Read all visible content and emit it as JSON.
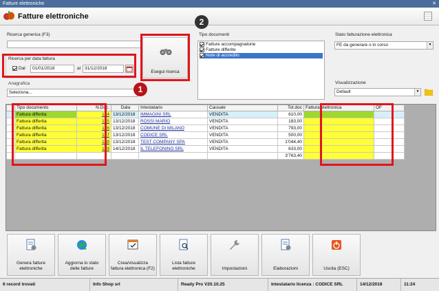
{
  "window": {
    "title": "Fatture elettroniche",
    "close": "✕"
  },
  "header": {
    "title": "Fatture elettroniche"
  },
  "search": {
    "generic_label": "Ricerca generica (F3)",
    "generic_value": "",
    "date_label": "Ricerca per data fattura",
    "from_label": "Dal",
    "from_value": "01/01/2018",
    "to_label": "al",
    "to_value": "31/12/2018",
    "anagrafica_label": "Anagrafica",
    "anagrafica_value": "Seleziona..."
  },
  "search_button": {
    "label": "Esegui ricerca"
  },
  "doc_types": {
    "label": "Tipo documenti",
    "items": [
      {
        "label": "Fatture accompagnatorie",
        "selected": false
      },
      {
        "label": "Fatture differite",
        "selected": false
      },
      {
        "label": "Note di accredito",
        "selected": true
      }
    ]
  },
  "stato": {
    "label": "Stato fatturazione elettronica",
    "value": "FE da generare o in corso"
  },
  "visualizzazione": {
    "label": "Visualizzazione",
    "value": "Default"
  },
  "badges": {
    "one": "1",
    "two": "2"
  },
  "table": {
    "columns": [
      "Tipo documento",
      "N.Doc.",
      "Data",
      "Intestatario",
      "Causale",
      "Tot.doc",
      "Fattura elettronica",
      "OF"
    ],
    "rows": [
      {
        "tipo": "Fattura differita",
        "ndoc": "134",
        "data": "13/12/2018",
        "intestatario": "IMMAGINI SRL",
        "causale": "VENDITA",
        "tot": "610,00",
        "fe": "",
        "of": ""
      },
      {
        "tipo": "Fattura differita",
        "ndoc": "135",
        "data": "13/12/2018",
        "intestatario": "ROSSI MARIO",
        "causale": "VENDITA",
        "tot": "183,00",
        "fe": "",
        "of": ""
      },
      {
        "tipo": "Fattura differita",
        "ndoc": "136",
        "data": "13/12/2018",
        "intestatario": "COMUNE DI MILANO",
        "causale": "VENDITA",
        "tot": "793,00",
        "fe": "",
        "of": ""
      },
      {
        "tipo": "Fattura differita",
        "ndoc": "137",
        "data": "13/12/2018",
        "intestatario": "CODICE SRL",
        "causale": "VENDITA",
        "tot": "500,00",
        "fe": "",
        "of": ""
      },
      {
        "tipo": "Fattura differita",
        "ndoc": "138",
        "data": "13/12/2018",
        "intestatario": "TEST COMPANY SPA",
        "causale": "VENDITA",
        "tot": "1'044,40",
        "fe": "",
        "of": ""
      },
      {
        "tipo": "Fattura differita",
        "ndoc": "139",
        "data": "14/12/2018",
        "intestatario": "IL TELEFONINO SRL",
        "causale": "VENDITA",
        "tot": "633,00",
        "fe": "",
        "of": ""
      }
    ],
    "total": "3'763,40"
  },
  "toolbar": [
    {
      "label": "Genera fatture elettroniche",
      "icon": "document-gear-icon"
    },
    {
      "label": "Aggiorna lo stato delle fatture",
      "icon": "globe-refresh-icon"
    },
    {
      "label": "Crea/visualizza fattura elettronica (F2)",
      "icon": "calendar-document-icon"
    },
    {
      "label": "Lista fatture elettroniche",
      "icon": "document-search-icon"
    },
    {
      "label": "Impostazioni",
      "icon": "wrench-icon"
    },
    {
      "label": "Elaborazioni",
      "icon": "document-gear-icon"
    },
    {
      "label": "Uscita (ESC)",
      "icon": "power-icon"
    }
  ],
  "status": {
    "records": "6 record trovati",
    "company": "Info Shop srl",
    "version": "Ready Pro V20.10.25",
    "license": "Intestatario licenza : CODICE SRL",
    "date": "14/12/2018",
    "time": "11:24"
  },
  "colors": {
    "highlight": "#ffff33",
    "selected_row": "#9fd82b",
    "annotation": "#e0141c"
  }
}
